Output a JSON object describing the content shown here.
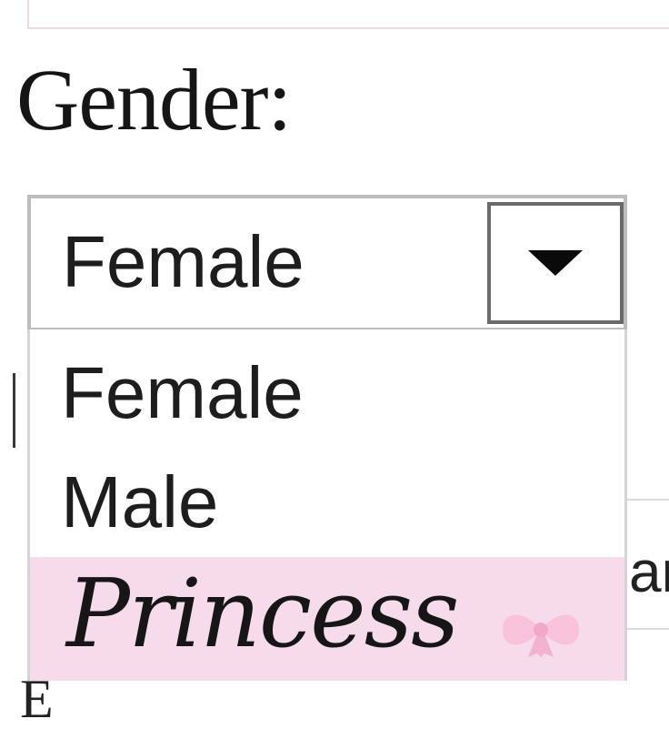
{
  "form": {
    "gender_label": "Gender:",
    "select": {
      "selected": "Female",
      "options": [
        "Female",
        "Male",
        "Princess"
      ],
      "highlight_color": "#f6dcea"
    },
    "right_fragment": "ar",
    "bottom_fragment": "E"
  }
}
